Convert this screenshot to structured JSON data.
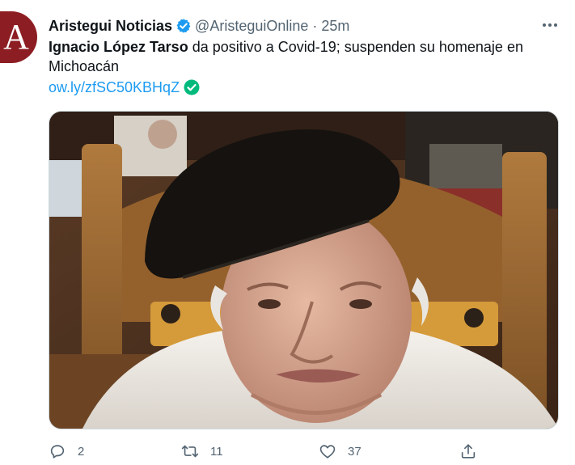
{
  "tweet": {
    "avatar_letter": "A",
    "display_name": "Aristegui Noticias",
    "handle": "@AristeguiOnline",
    "separator": "·",
    "time": "25m",
    "text_bold": "Ignacio López Tarso",
    "text_rest": " da positivo a Covid-19; suspenden su homenaje en Michoacán",
    "link": "ow.ly/zfSC50KBHqZ",
    "icons": {
      "verified": "verified-badge-icon",
      "more": "more-options-icon",
      "link_check": "check-circle-icon",
      "reply": "reply-icon",
      "retweet": "retweet-icon",
      "like": "like-icon",
      "share": "share-icon"
    },
    "colors": {
      "brand_avatar": "#8c1d22",
      "verified": "#1d9bf0",
      "link": "#1d9bf0",
      "check": "#00ba7c",
      "muted": "#536471"
    },
    "actions": {
      "reply_count": "2",
      "retweet_count": "11",
      "like_count": "37"
    }
  }
}
